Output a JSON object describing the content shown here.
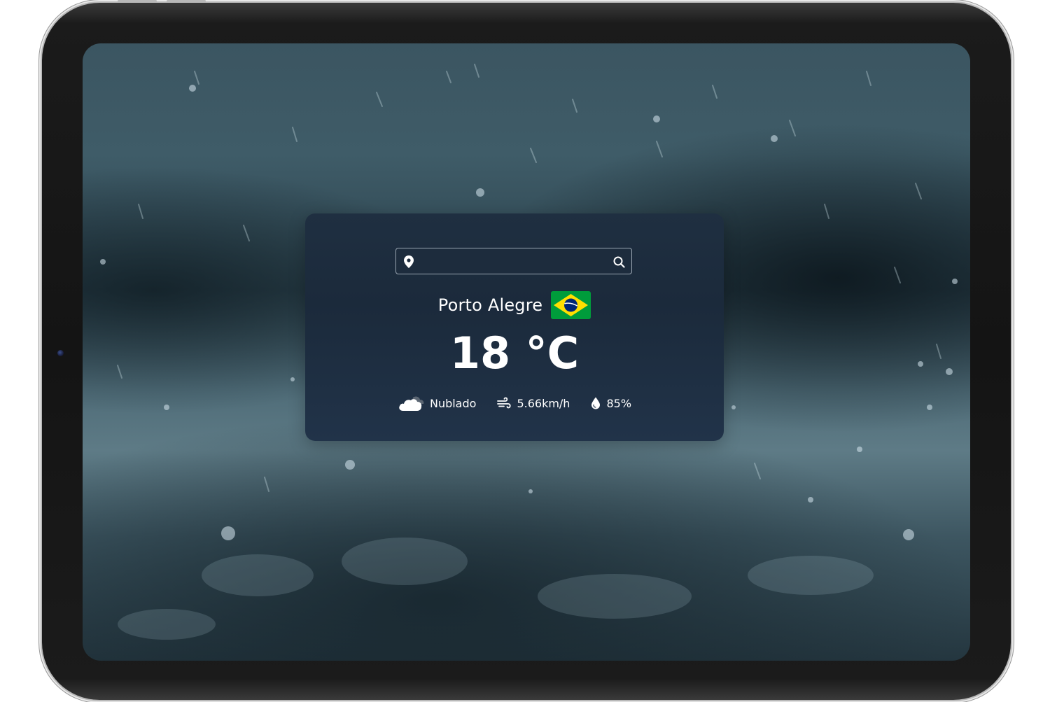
{
  "search": {
    "placeholder": "",
    "value": ""
  },
  "weather": {
    "city": "Porto Alegre",
    "country_flag": "brazil-flag",
    "temperature": "18 °C",
    "description": "Nublado",
    "wind": "5.66km/h",
    "humidity": "85%"
  },
  "icons": {
    "location": "map-pin-icon",
    "search": "search-icon",
    "condition": "cloud-icon",
    "wind": "wind-icon",
    "humidity": "water-drop-icon"
  },
  "colors": {
    "card_background": "#1b2a3b",
    "text": "#ffffff",
    "search_border": "#9aa6b2",
    "flag_green": "#009c3b",
    "flag_yellow": "#ffdf00",
    "flag_blue": "#002776"
  }
}
